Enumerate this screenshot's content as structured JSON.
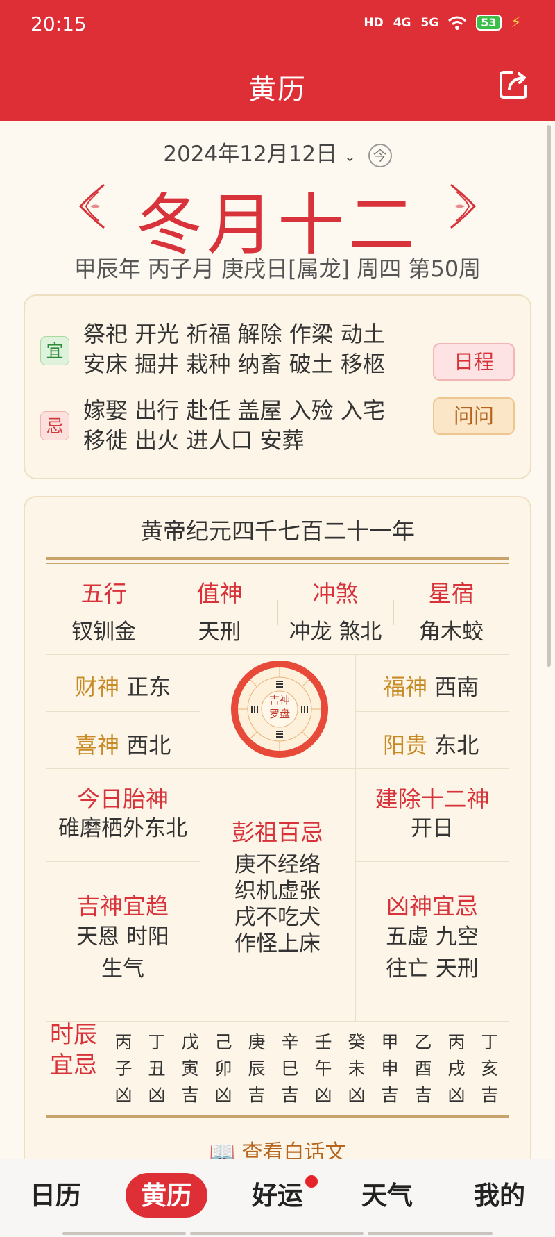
{
  "status": {
    "time": "20:15",
    "hd": "HD",
    "net1": "4G",
    "net2": "5G",
    "battery": "53"
  },
  "appbar": {
    "title": "黄历"
  },
  "date": {
    "solar": "2024年12月12日",
    "today_badge": "今",
    "lunar": "冬月十二",
    "ganzhi": "甲辰年 丙子月 庚戌日[属龙] 周四 第50周"
  },
  "yiji": {
    "yi_label": "宜",
    "yi_lines": [
      "祭祀 开光 祈福 解除 作梁 动土",
      "安床 掘井 栽种 纳畜 破土 移柩"
    ],
    "ji_label": "忌",
    "ji_lines": [
      "嫁娶 出行 赴任 盖屋 入殓 入宅",
      "移徙 出火 进人口 安葬"
    ],
    "schedule_button": "日程",
    "ask_button": "问问"
  },
  "almanac": {
    "era": "黄帝纪元四千七百二十一年",
    "four": [
      {
        "k": "五行",
        "v": "钗钏金"
      },
      {
        "k": "值神",
        "v": "天刑"
      },
      {
        "k": "冲煞",
        "v": "冲龙 煞北"
      },
      {
        "k": "星宿",
        "v": "角木蛟"
      }
    ],
    "gods": {
      "cai_k": "财神",
      "cai_v": "正东",
      "xi_k": "喜神",
      "xi_v": "西北",
      "fu_k": "福神",
      "fu_v": "西南",
      "yang_k": "阳贵",
      "yang_v": "东北"
    },
    "compass": {
      "l1": "吉神",
      "l2": "罗盘"
    },
    "taishen": {
      "title": "今日胎神",
      "text": "碓磨栖外东北"
    },
    "jianchu": {
      "title": "建除十二神",
      "text": "开日"
    },
    "pengzu": {
      "title": "彭祖百忌",
      "lines": [
        "庚不经络",
        "织机虚张",
        "戌不吃犬",
        "作怪上床"
      ]
    },
    "jishen": {
      "title": "吉神宜趋",
      "lines": [
        "天恩 时阳",
        "生气"
      ]
    },
    "xiongshen": {
      "title": "凶神宜忌",
      "lines": [
        "五虚 九空",
        "往亡 天刑"
      ]
    },
    "hours_label": [
      "时辰",
      "宜忌"
    ],
    "hours": [
      [
        "丙",
        "子",
        "凶"
      ],
      [
        "丁",
        "丑",
        "凶"
      ],
      [
        "戊",
        "寅",
        "吉"
      ],
      [
        "己",
        "卯",
        "凶"
      ],
      [
        "庚",
        "辰",
        "吉"
      ],
      [
        "辛",
        "巳",
        "吉"
      ],
      [
        "壬",
        "午",
        "凶"
      ],
      [
        "癸",
        "未",
        "凶"
      ],
      [
        "甲",
        "申",
        "吉"
      ],
      [
        "乙",
        "酉",
        "吉"
      ],
      [
        "丙",
        "戌",
        "凶"
      ],
      [
        "丁",
        "亥",
        "吉"
      ]
    ],
    "view_plain": "查看白话文"
  },
  "tabs": [
    "日历",
    "黄历",
    "好运",
    "天气",
    "我的"
  ]
}
